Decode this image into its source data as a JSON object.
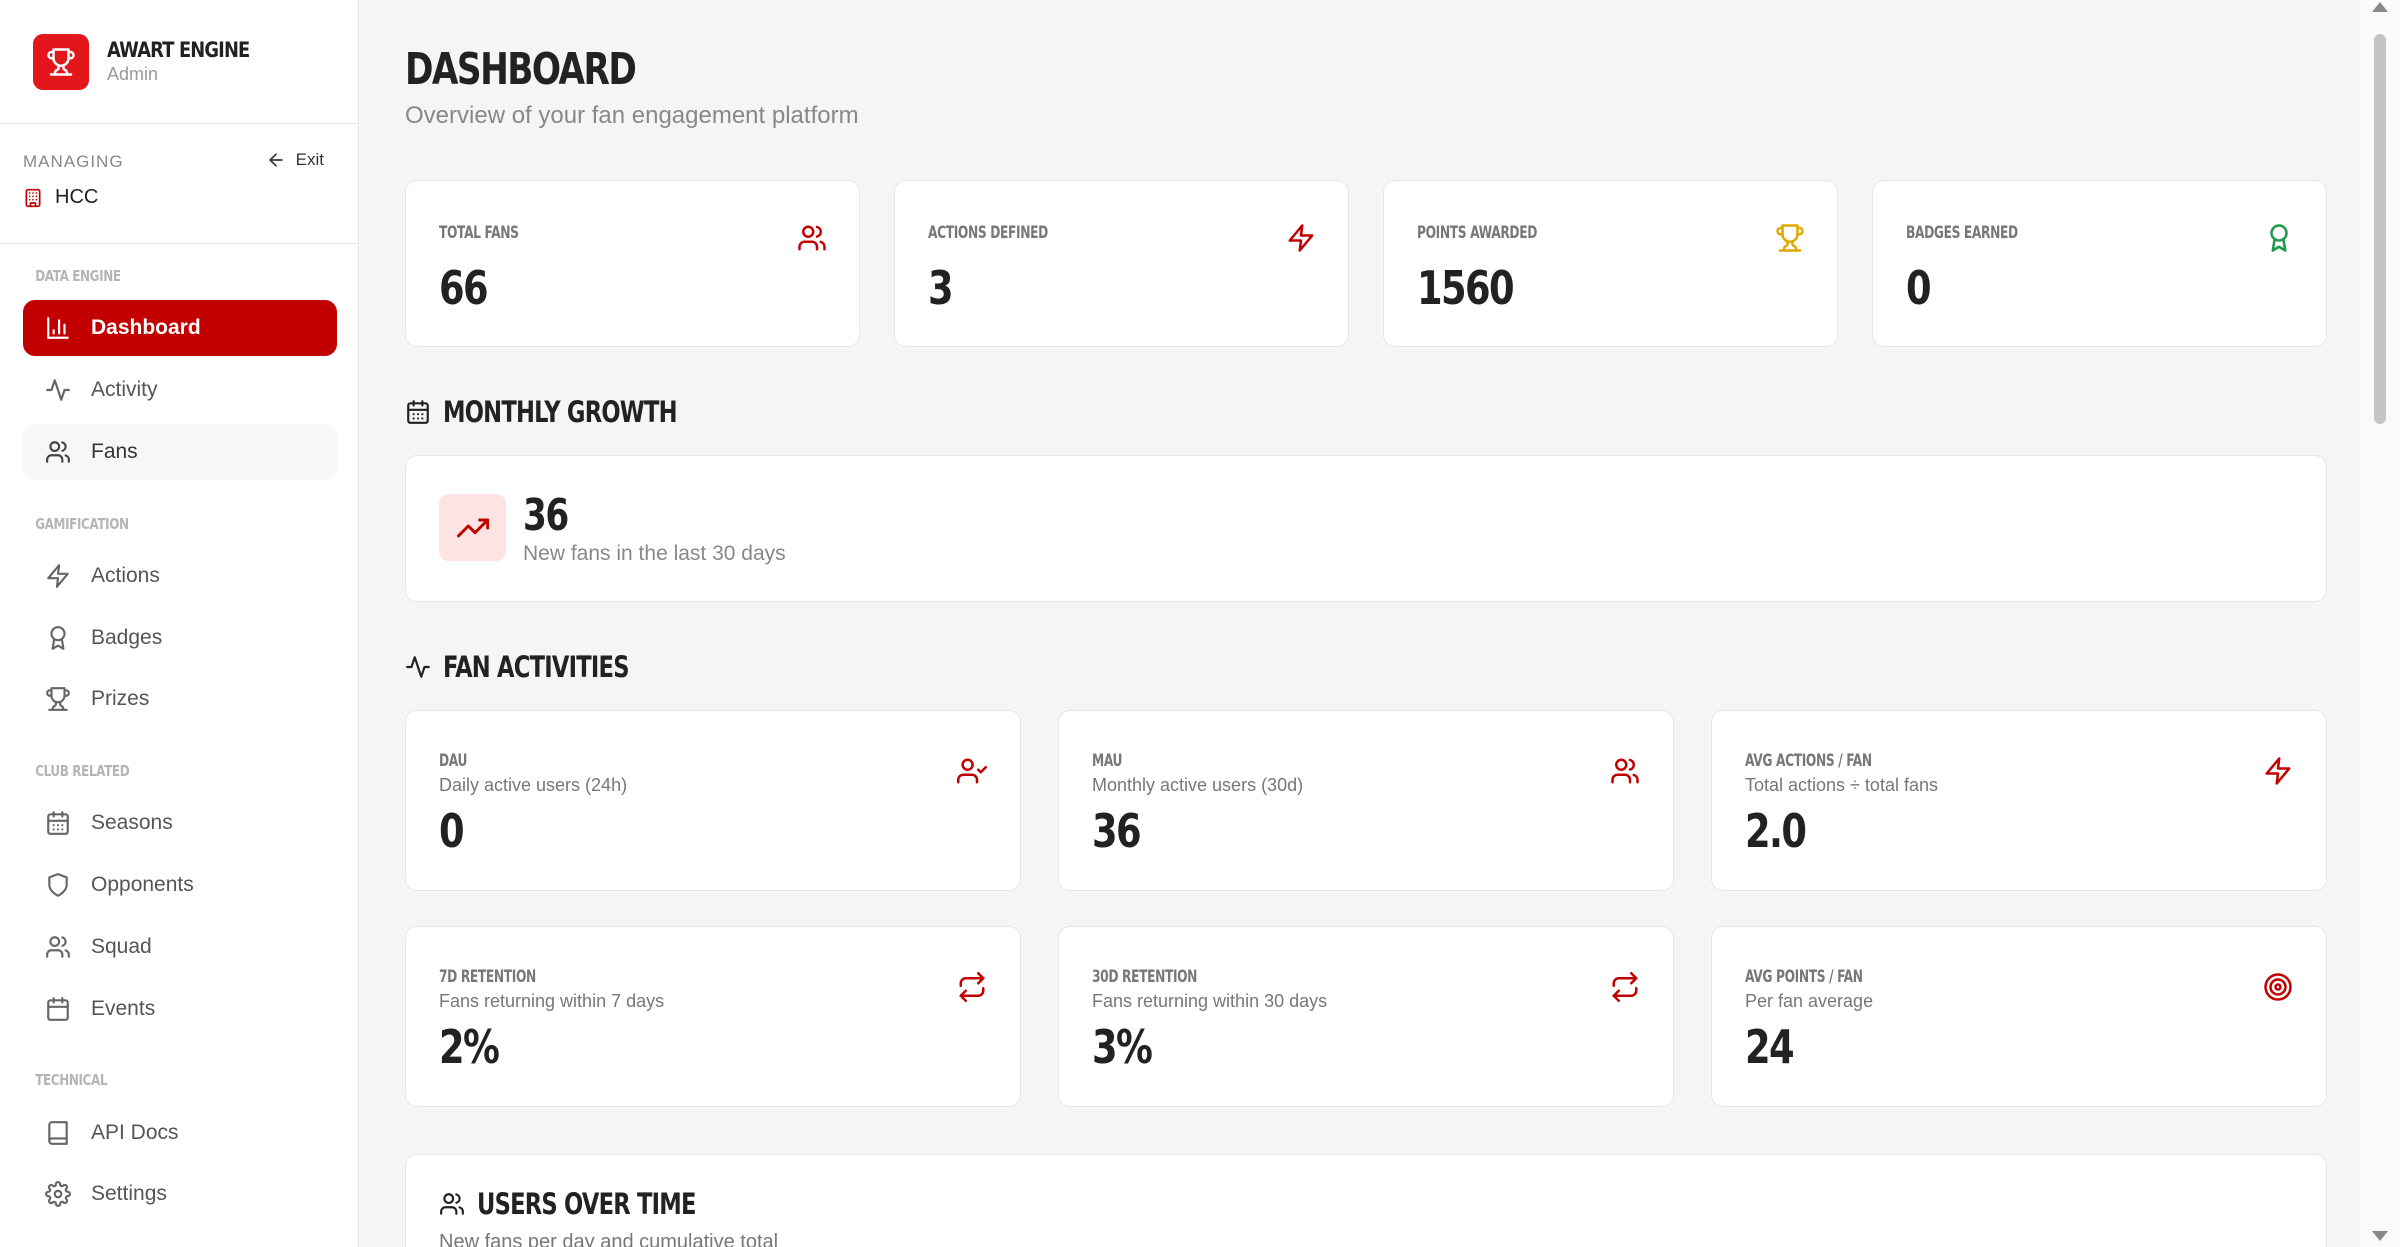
{
  "brand": {
    "title": "AWART ENGINE",
    "subtitle": "Admin"
  },
  "managing": {
    "label": "MANAGING",
    "exit_label": "Exit",
    "club": "HCC"
  },
  "sidebar": {
    "sections": [
      {
        "title": "DATA ENGINE",
        "items": [
          {
            "label": "Dashboard",
            "icon": "bar-chart-icon",
            "active": true
          },
          {
            "label": "Activity",
            "icon": "activity-icon"
          },
          {
            "label": "Fans",
            "icon": "users-icon"
          }
        ]
      },
      {
        "title": "GAMIFICATION",
        "items": [
          {
            "label": "Actions",
            "icon": "zap-icon"
          },
          {
            "label": "Badges",
            "icon": "award-icon"
          },
          {
            "label": "Prizes",
            "icon": "trophy-icon"
          }
        ]
      },
      {
        "title": "CLUB RELATED",
        "items": [
          {
            "label": "Seasons",
            "icon": "calendar-icon"
          },
          {
            "label": "Opponents",
            "icon": "shield-icon"
          },
          {
            "label": "Squad",
            "icon": "users-icon"
          },
          {
            "label": "Events",
            "icon": "calendar-icon"
          }
        ]
      },
      {
        "title": "TECHNICAL",
        "items": [
          {
            "label": "API Docs",
            "icon": "book-icon"
          },
          {
            "label": "Settings",
            "icon": "gear-icon"
          }
        ]
      }
    ]
  },
  "page": {
    "title": "DASHBOARD",
    "subtitle": "Overview of your fan engagement platform"
  },
  "stats": [
    {
      "label": "TOTAL FANS",
      "value": "66",
      "icon": "users-icon",
      "color": "#c30000"
    },
    {
      "label": "ACTIONS DEFINED",
      "value": "3",
      "icon": "zap-icon",
      "color": "#c30000"
    },
    {
      "label": "POINTS AWARDED",
      "value": "1560",
      "icon": "trophy-icon",
      "color": "#e0a800"
    },
    {
      "label": "BADGES EARNED",
      "value": "0",
      "icon": "award-icon",
      "color": "#1a9a4a"
    }
  ],
  "monthly_growth": {
    "title": "MONTHLY GROWTH",
    "value": "36",
    "description": "New fans in the last 30 days"
  },
  "fan_activities": {
    "title": "FAN ACTIVITIES",
    "cards": [
      {
        "label": "DAU",
        "description": "Daily active users (24h)",
        "value": "0",
        "icon": "user-check-icon"
      },
      {
        "label": "MAU",
        "description": "Monthly active users (30d)",
        "value": "36",
        "icon": "users-icon"
      },
      {
        "label": "AVG ACTIONS / FAN",
        "description": "Total actions ÷ total fans",
        "value": "2.0",
        "icon": "zap-icon"
      },
      {
        "label": "7D RETENTION",
        "description": "Fans returning within 7 days",
        "value": "2%",
        "icon": "repeat-icon"
      },
      {
        "label": "30D RETENTION",
        "description": "Fans returning within 30 days",
        "value": "3%",
        "icon": "repeat-icon"
      },
      {
        "label": "AVG POINTS / FAN",
        "description": "Per fan average",
        "value": "24",
        "icon": "target-icon"
      }
    ]
  },
  "users_over_time": {
    "title": "USERS OVER TIME",
    "subtitle": "New fans per day and cumulative total"
  },
  "colors": {
    "accent": "#c30000",
    "brand": "#e3161b"
  }
}
